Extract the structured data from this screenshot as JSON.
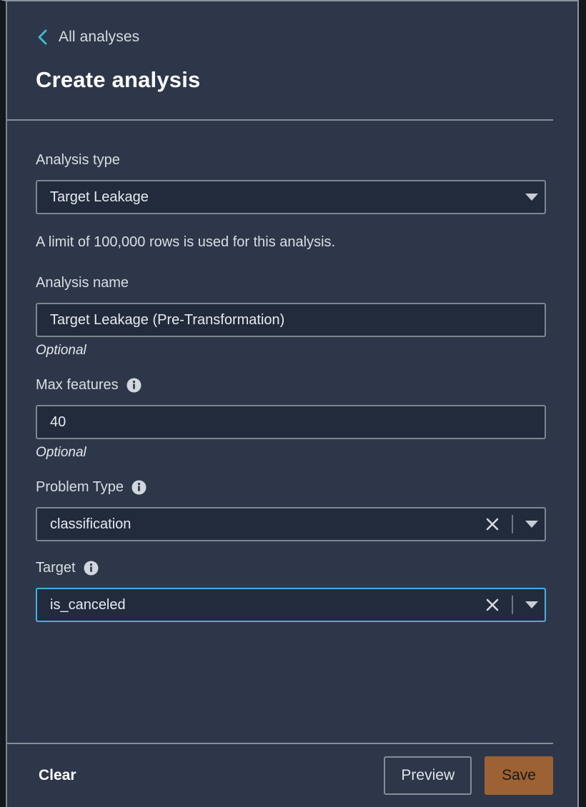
{
  "header": {
    "back_label": "All analyses",
    "back_icon": "chevron-left-icon",
    "title": "Create analysis"
  },
  "form": {
    "analysis_type": {
      "label": "Analysis type",
      "value": "Target Leakage",
      "caret_icon": "chevron-down-icon"
    },
    "limit_note": "A limit of 100,000 rows is used for this analysis.",
    "analysis_name": {
      "label": "Analysis name",
      "value": "Target Leakage (Pre-Transformation)",
      "optional": "Optional"
    },
    "max_features": {
      "label": "Max features",
      "info_icon": "info-icon",
      "value": "40",
      "optional": "Optional"
    },
    "problem_type": {
      "label": "Problem Type",
      "info_icon": "info-icon",
      "value": "classification",
      "clear_icon": "close-icon",
      "caret_icon": "chevron-down-icon"
    },
    "target": {
      "label": "Target",
      "info_icon": "info-icon",
      "value": "is_canceled",
      "clear_icon": "close-icon",
      "caret_icon": "chevron-down-icon",
      "focused": true
    }
  },
  "footer": {
    "clear_label": "Clear",
    "preview_label": "Preview",
    "save_label": "Save"
  },
  "colors": {
    "panel_background": "#2e3749",
    "input_background": "#222b3c",
    "border": "#7d8690",
    "accent_link": "#44b9d6",
    "focus_border": "#44aee3",
    "save_button": "#9c6233",
    "text_primary": "#e6eaf0"
  }
}
